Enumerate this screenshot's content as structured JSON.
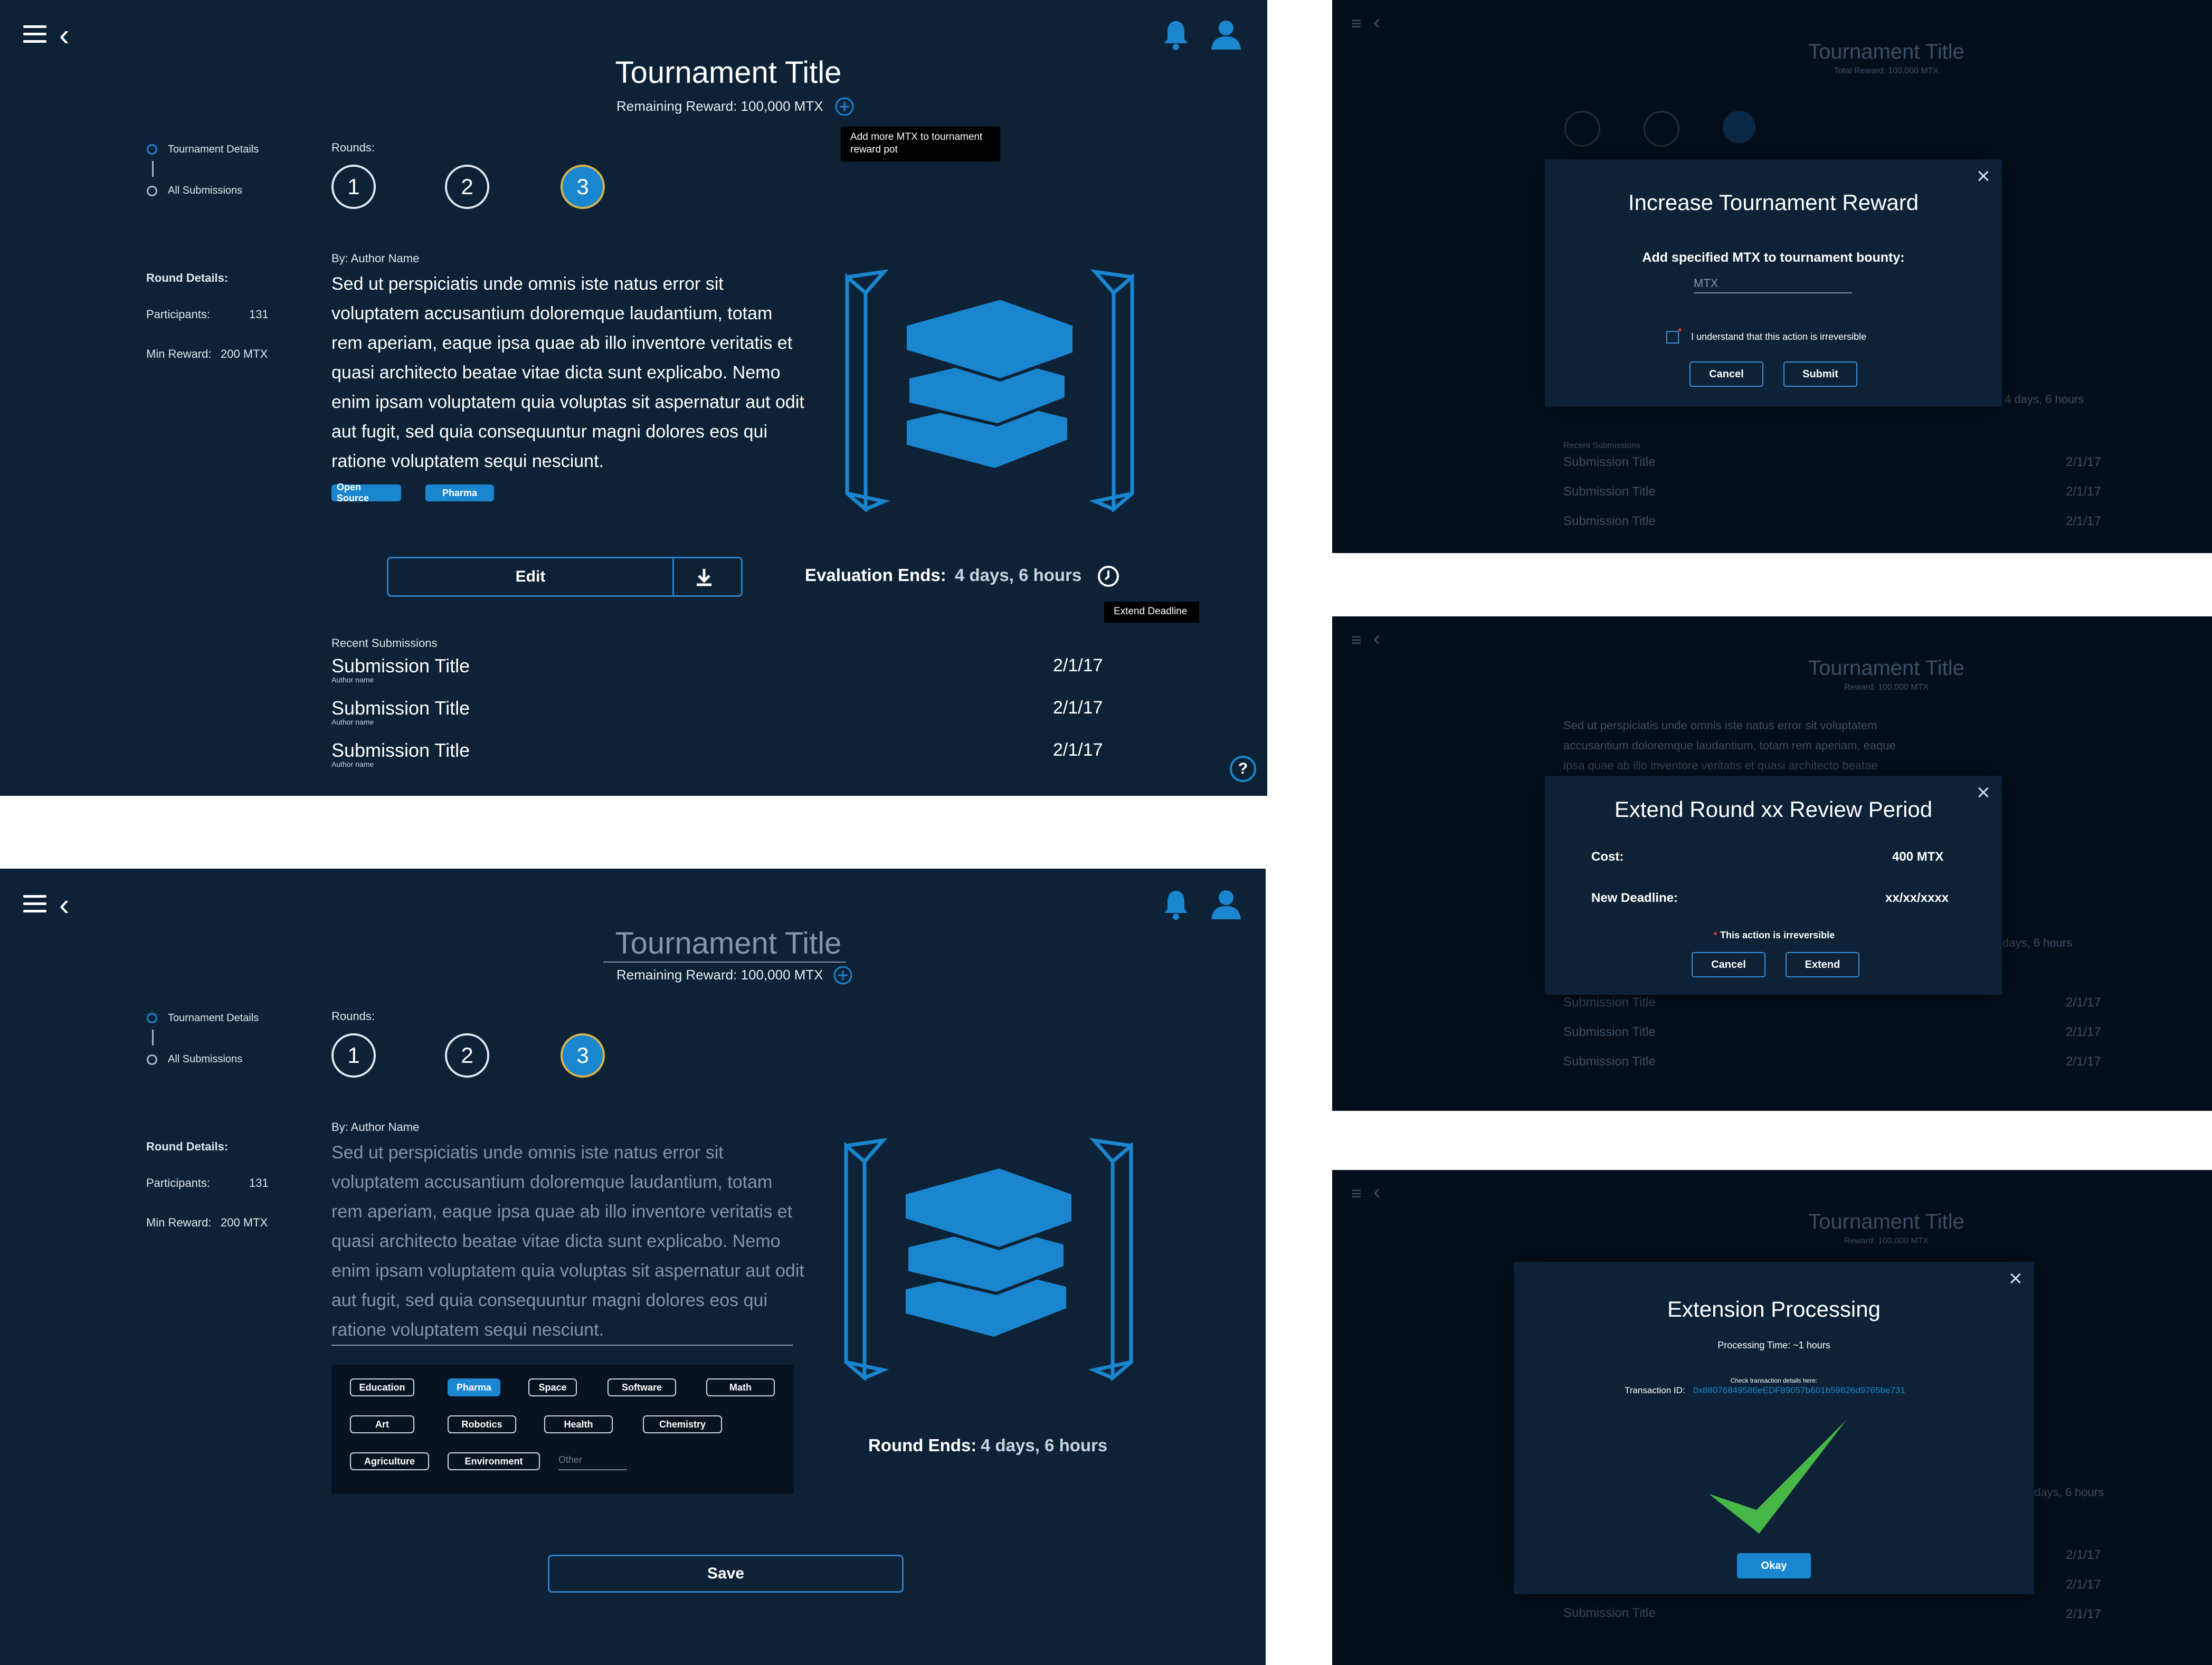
{
  "common": {
    "tournament_title": "Tournament Title",
    "remaining_reward": "Remaining Reward: 100,000 MTX",
    "reward_dim": "Total Reward: 100,000 MTX",
    "reward_dim_short": "Reward: 100,000 MTX",
    "nav": {
      "details": "Tournament Details",
      "submissions": "All Submissions"
    },
    "rounds_label": "Rounds:",
    "rounds": [
      "1",
      "2",
      "3"
    ],
    "round_details": "Round Details:",
    "participants_label": "Participants:",
    "participants_value": "131",
    "min_reward_label": "Min Reward:",
    "min_reward_value": "200 MTX",
    "author": "By: Author Name",
    "body": "Sed ut perspiciatis unde omnis iste natus error sit voluptatem accusantium doloremque laudantium, totam rem aperiam, eaque ipsa quae ab illo inventore veritatis et quasi architecto beatae vitae dicta sunt explicabo. Nemo enim ipsam voluptatem quia voluptas sit aspernatur aut odit aut fugit, sed quia consequuntur magni dolores eos qui ratione voluptatem sequi nesciunt.",
    "colors": {
      "bg": "#0d2236",
      "accent": "#1a86cf",
      "active_ring": "#d7b44a",
      "success": "#47b847"
    }
  },
  "screen1": {
    "tooltip_reward": "Add more MTX to tournament reward pot",
    "tags": [
      "Open Source",
      "Pharma"
    ],
    "edit_label": "Edit",
    "evaluation_label": "Evaluation Ends:",
    "evaluation_value": "4 days, 6 hours",
    "extend_tooltip": "Extend Deadline",
    "recent_label": "Recent Submissions",
    "submissions": [
      {
        "title": "Submission Title",
        "author": "Author name",
        "date": "2/1/17"
      },
      {
        "title": "Submission Title",
        "author": "Author name",
        "date": "2/1/17"
      },
      {
        "title": "Submission Title",
        "author": "Author name",
        "date": "2/1/17"
      }
    ],
    "help": "?"
  },
  "screen2": {
    "categories": [
      "Education",
      "Pharma",
      "Space",
      "Software",
      "Math",
      "Art",
      "Robotics",
      "Health",
      "Chemistry",
      "Agriculture",
      "Environment"
    ],
    "selected_category": "Pharma",
    "other_placeholder": "Other",
    "round_ends_label": "Round Ends:",
    "round_ends_value": "4 days, 6 hours",
    "save_label": "Save"
  },
  "modal_reward": {
    "title": "Increase Tournament Reward",
    "prompt": "Add specified MTX to tournament bounty:",
    "input_placeholder": "MTX",
    "checkbox_label": "I understand that this action is irreversible",
    "cancel": "Cancel",
    "submit": "Submit"
  },
  "modal_extend": {
    "title": "Extend Round xx Review Period",
    "cost_label": "Cost:",
    "cost_value": "400 MTX",
    "deadline_label": "New Deadline:",
    "deadline_value": "xx/xx/xxxx",
    "warning": "This action is irreversible",
    "cancel": "Cancel",
    "extend": "Extend"
  },
  "modal_processing": {
    "title": "Extension Processing",
    "processing_time": "Processing Time: ~1 hours",
    "check_note": "Check transaction details here:",
    "tx_label": "Transaction ID:",
    "tx_value": "0x88076849586eEDF89057b601b59826d9765be731",
    "okay": "Okay"
  },
  "background_dim": {
    "ev_partial": "4 days, 6 hours",
    "ev_partial2": "days, 6 hours",
    "extend_tooltip": "Extend Deadline",
    "recent_label": "Recent Submissions"
  }
}
